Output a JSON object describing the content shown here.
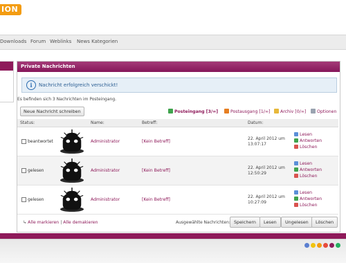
{
  "header": {
    "logo_fragment": "ION",
    "logo_color": "#f39c12"
  },
  "nav": {
    "items": [
      {
        "label": "Downloads"
      },
      {
        "label": "Forum"
      },
      {
        "label": "Weblinks"
      },
      {
        "label": "News Kategorien"
      }
    ]
  },
  "panel": {
    "title": "Private Nachrichten",
    "accent_color": "#8e1a5a"
  },
  "notice": {
    "icon": "info-icon",
    "text": "Nachricht erfolgreich verschickt!"
  },
  "inbox": {
    "info": "Es befinden sich 3 Nachrichten im Posteingang.",
    "new_message_label": "Neue Nachricht schreiben",
    "folders": [
      {
        "label": "Posteingang [3/∞]",
        "icon": "inbox-icon",
        "active": true
      },
      {
        "label": "Postausgang [1/∞]",
        "icon": "outbox-icon",
        "active": false
      },
      {
        "label": "Archiv [0/∞]",
        "icon": "archive-folder-icon",
        "active": false
      },
      {
        "label": "Optionen",
        "icon": "wrench-icon",
        "active": false
      }
    ],
    "columns": {
      "status": "Status:",
      "name": "Name:",
      "subject": "Betreff:",
      "date": "Datum:"
    },
    "messages": [
      {
        "status": "beantwortet",
        "sender": "Administrator",
        "subject": "[Kein Betreff]",
        "date_line1": "22. April 2012 um",
        "date_line2": "13:07:17",
        "actions": {
          "read": "Lesen",
          "reply": "Antworten",
          "delete": "Löschen"
        }
      },
      {
        "status": "gelesen",
        "sender": "Administrator",
        "subject": "[Kein Betreff]",
        "date_line1": "22. April 2012 um",
        "date_line2": "12:50:29",
        "actions": {
          "read": "Lesen",
          "reply": "Antworten",
          "delete": "Löschen"
        }
      },
      {
        "status": "gelesen",
        "sender": "Administrator",
        "subject": "[Kein Betreff]",
        "date_line1": "22. April 2012 um",
        "date_line2": "10:27:09",
        "actions": {
          "read": "Lesen",
          "reply": "Antworten",
          "delete": "Löschen"
        }
      }
    ],
    "select_all": "Alle markieren",
    "separator": "|",
    "deselect_all": "Alle demakieren",
    "selected_label": "Ausgewählte Nachrichten:",
    "buttons": {
      "save": "Speichern",
      "read": "Lesen",
      "unread": "Ungelesen",
      "delete": "Löschen"
    }
  },
  "footer": {
    "dot_colors": [
      "#5b7fd0",
      "#f1c40f",
      "#f39c12",
      "#e74c3c",
      "#8e1a5a",
      "#27ae60"
    ]
  }
}
